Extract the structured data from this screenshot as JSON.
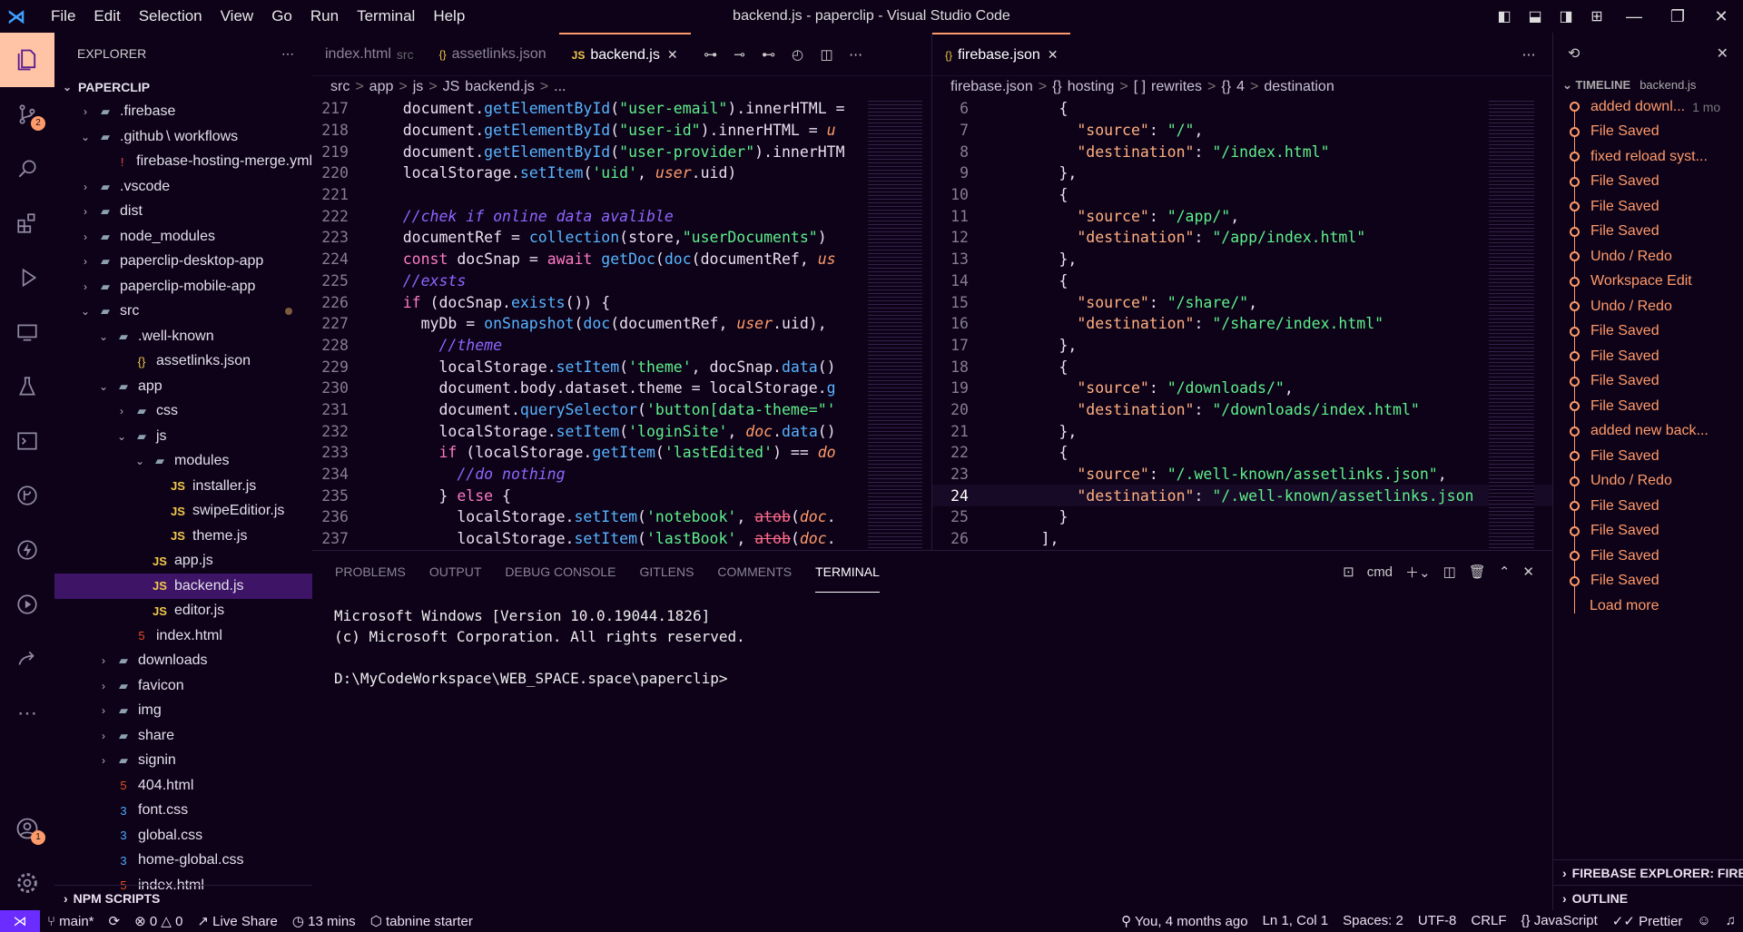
{
  "window": {
    "title": "backend.js - paperclip - Visual Studio Code"
  },
  "menu": [
    "File",
    "Edit",
    "Selection",
    "View",
    "Go",
    "Run",
    "Terminal",
    "Help"
  ],
  "activity": {
    "scm_badge": "2",
    "accounts_badge": "1"
  },
  "explorer": {
    "title": "EXPLORER",
    "root": "PAPERCLIP",
    "items": [
      {
        "label": ".firebase",
        "depth": 1,
        "kind": "folder",
        "open": false
      },
      {
        "label": ".github",
        "extra": "\\ workflows",
        "depth": 1,
        "kind": "folder",
        "open": true
      },
      {
        "label": "firebase-hosting-merge.yml",
        "depth": 2,
        "kind": "yml"
      },
      {
        "label": ".vscode",
        "depth": 1,
        "kind": "folder",
        "open": false
      },
      {
        "label": "dist",
        "depth": 1,
        "kind": "folder",
        "open": false
      },
      {
        "label": "node_modules",
        "depth": 1,
        "kind": "folder",
        "open": false
      },
      {
        "label": "paperclip-desktop-app",
        "depth": 1,
        "kind": "folder",
        "open": false
      },
      {
        "label": "paperclip-mobile-app",
        "depth": 1,
        "kind": "folder",
        "open": false
      },
      {
        "label": "src",
        "depth": 1,
        "kind": "folder",
        "open": true,
        "modified": true
      },
      {
        "label": ".well-known",
        "depth": 2,
        "kind": "folder",
        "open": true
      },
      {
        "label": "assetlinks.json",
        "depth": 3,
        "kind": "json"
      },
      {
        "label": "app",
        "depth": 2,
        "kind": "folder",
        "open": true
      },
      {
        "label": "css",
        "depth": 3,
        "kind": "folder",
        "open": false
      },
      {
        "label": "js",
        "depth": 3,
        "kind": "folder",
        "open": true
      },
      {
        "label": "modules",
        "depth": 4,
        "kind": "folder",
        "open": true
      },
      {
        "label": "installer.js",
        "depth": 5,
        "kind": "js"
      },
      {
        "label": "swipeEditior.js",
        "depth": 5,
        "kind": "js"
      },
      {
        "label": "theme.js",
        "depth": 5,
        "kind": "js"
      },
      {
        "label": "app.js",
        "depth": 4,
        "kind": "js"
      },
      {
        "label": "backend.js",
        "depth": 4,
        "kind": "js",
        "selected": true
      },
      {
        "label": "editor.js",
        "depth": 4,
        "kind": "js"
      },
      {
        "label": "index.html",
        "depth": 3,
        "kind": "html"
      },
      {
        "label": "downloads",
        "depth": 2,
        "kind": "folder",
        "open": false
      },
      {
        "label": "favicon",
        "depth": 2,
        "kind": "folder",
        "open": false
      },
      {
        "label": "img",
        "depth": 2,
        "kind": "folder",
        "open": false
      },
      {
        "label": "share",
        "depth": 2,
        "kind": "folder",
        "open": false
      },
      {
        "label": "signin",
        "depth": 2,
        "kind": "folder",
        "open": false
      },
      {
        "label": "404.html",
        "depth": 2,
        "kind": "html"
      },
      {
        "label": "font.css",
        "depth": 2,
        "kind": "css"
      },
      {
        "label": "global.css",
        "depth": 2,
        "kind": "css"
      },
      {
        "label": "home-global.css",
        "depth": 2,
        "kind": "css"
      },
      {
        "label": "index.html",
        "depth": 2,
        "kind": "html"
      }
    ],
    "npm_scripts": "NPM SCRIPTS"
  },
  "editor_left": {
    "tabs": [
      {
        "label": "index.html",
        "desc": "src",
        "kind": "html",
        "active": false
      },
      {
        "label": "assetlinks.json",
        "kind": "json",
        "active": false
      },
      {
        "label": "backend.js",
        "kind": "js",
        "active": true
      }
    ],
    "breadcrumb": [
      "src",
      ">",
      "app",
      ">",
      "js",
      ">",
      "JS",
      "backend.js",
      ">",
      "..."
    ],
    "lines": [
      {
        "n": "217",
        "tokens": [
          [
            "p",
            "    document."
          ],
          [
            "f",
            "getElementById"
          ],
          [
            "p",
            "("
          ],
          [
            "s",
            "\"user-email\""
          ],
          [
            "p",
            ").innerHTML = "
          ]
        ]
      },
      {
        "n": "218",
        "tokens": [
          [
            "p",
            "    document."
          ],
          [
            "f",
            "getElementById"
          ],
          [
            "p",
            "("
          ],
          [
            "s",
            "\"user-id\""
          ],
          [
            "p",
            ").innerHTML = "
          ],
          [
            "i",
            "u"
          ]
        ]
      },
      {
        "n": "219",
        "tokens": [
          [
            "p",
            "    document."
          ],
          [
            "f",
            "getElementById"
          ],
          [
            "p",
            "("
          ],
          [
            "s",
            "\"user-provider\""
          ],
          [
            "p",
            ").innerHTM"
          ]
        ]
      },
      {
        "n": "220",
        "tokens": [
          [
            "p",
            "    localStorage."
          ],
          [
            "f",
            "setItem"
          ],
          [
            "p",
            "("
          ],
          [
            "s",
            "'uid'"
          ],
          [
            "p",
            ", "
          ],
          [
            "i",
            "user"
          ],
          [
            "p",
            ".uid)"
          ]
        ]
      },
      {
        "n": "221",
        "tokens": [
          [
            "p",
            " "
          ]
        ]
      },
      {
        "n": "222",
        "tokens": [
          [
            "p",
            "    "
          ],
          [
            "c",
            "//chek if online data avalible"
          ]
        ]
      },
      {
        "n": "223",
        "tokens": [
          [
            "p",
            "    documentRef = "
          ],
          [
            "f",
            "collection"
          ],
          [
            "p",
            "(store,"
          ],
          [
            "s",
            "\"userDocuments\""
          ],
          [
            "p",
            ")"
          ]
        ]
      },
      {
        "n": "224",
        "tokens": [
          [
            "k",
            "    const "
          ],
          [
            "p",
            "docSnap = "
          ],
          [
            "k",
            "await "
          ],
          [
            "f",
            "getDoc"
          ],
          [
            "p",
            "("
          ],
          [
            "f",
            "doc"
          ],
          [
            "p",
            "(documentRef, "
          ],
          [
            "i",
            "us"
          ]
        ]
      },
      {
        "n": "225",
        "tokens": [
          [
            "p",
            "    "
          ],
          [
            "c",
            "//exsts"
          ]
        ]
      },
      {
        "n": "226",
        "tokens": [
          [
            "k",
            "    if "
          ],
          [
            "p",
            "(docSnap."
          ],
          [
            "f",
            "exists"
          ],
          [
            "p",
            "()) {"
          ]
        ]
      },
      {
        "n": "227",
        "tokens": [
          [
            "p",
            "      myDb = "
          ],
          [
            "f",
            "onSnapshot"
          ],
          [
            "p",
            "("
          ],
          [
            "f",
            "doc"
          ],
          [
            "p",
            "(documentRef, "
          ],
          [
            "i",
            "user"
          ],
          [
            "p",
            ".uid), "
          ]
        ]
      },
      {
        "n": "228",
        "tokens": [
          [
            "p",
            "        "
          ],
          [
            "c",
            "//theme"
          ]
        ]
      },
      {
        "n": "229",
        "tokens": [
          [
            "p",
            "        localStorage."
          ],
          [
            "f",
            "setItem"
          ],
          [
            "p",
            "("
          ],
          [
            "s",
            "'theme'"
          ],
          [
            "p",
            ", docSnap."
          ],
          [
            "f",
            "data"
          ],
          [
            "p",
            "()"
          ]
        ]
      },
      {
        "n": "230",
        "tokens": [
          [
            "p",
            "        document.body.dataset.theme = localStorage."
          ],
          [
            "f",
            "g"
          ]
        ]
      },
      {
        "n": "231",
        "tokens": [
          [
            "p",
            "        document."
          ],
          [
            "f",
            "querySelector"
          ],
          [
            "p",
            "("
          ],
          [
            "s",
            "'button[data-theme=\"'"
          ]
        ]
      },
      {
        "n": "232",
        "tokens": [
          [
            "p",
            "        localStorage."
          ],
          [
            "f",
            "setItem"
          ],
          [
            "p",
            "("
          ],
          [
            "s",
            "'loginSite'"
          ],
          [
            "p",
            ", "
          ],
          [
            "i",
            "doc"
          ],
          [
            "p",
            "."
          ],
          [
            "f",
            "data"
          ],
          [
            "p",
            "()"
          ]
        ]
      },
      {
        "n": "233",
        "tokens": [
          [
            "k",
            "        if "
          ],
          [
            "p",
            "(localStorage."
          ],
          [
            "f",
            "getItem"
          ],
          [
            "p",
            "("
          ],
          [
            "s",
            "'lastEdited'"
          ],
          [
            "p",
            ") == "
          ],
          [
            "i",
            "do"
          ]
        ]
      },
      {
        "n": "234",
        "tokens": [
          [
            "p",
            "          "
          ],
          [
            "c",
            "//do nothing"
          ]
        ]
      },
      {
        "n": "235",
        "tokens": [
          [
            "p",
            "        } "
          ],
          [
            "k",
            "else "
          ],
          [
            "p",
            "{"
          ]
        ]
      },
      {
        "n": "236",
        "tokens": [
          [
            "p",
            "          localStorage."
          ],
          [
            "f",
            "setItem"
          ],
          [
            "p",
            "("
          ],
          [
            "s",
            "'notebook'"
          ],
          [
            "p",
            ", "
          ],
          [
            "x",
            "atob"
          ],
          [
            "p",
            "("
          ],
          [
            "i",
            "doc"
          ],
          [
            "p",
            "."
          ]
        ]
      },
      {
        "n": "237",
        "tokens": [
          [
            "p",
            "          localStorage."
          ],
          [
            "f",
            "setItem"
          ],
          [
            "p",
            "("
          ],
          [
            "s",
            "'lastBook'"
          ],
          [
            "p",
            ", "
          ],
          [
            "x",
            "atob"
          ],
          [
            "p",
            "("
          ],
          [
            "i",
            "doc"
          ],
          [
            "p",
            "."
          ]
        ]
      }
    ]
  },
  "editor_right": {
    "tabs": [
      {
        "label": "firebase.json",
        "kind": "json",
        "active": true
      }
    ],
    "breadcrumb": [
      "firebase.json",
      ">",
      "{}",
      "hosting",
      ">",
      "[ ]",
      "rewrites",
      ">",
      "{}",
      "4",
      ">",
      "destination"
    ],
    "lines": [
      {
        "n": "6",
        "tokens": [
          [
            "p",
            "        {"
          ]
        ]
      },
      {
        "n": "7",
        "tokens": [
          [
            "y",
            "          \"source\""
          ],
          [
            "p",
            ": "
          ],
          [
            "s",
            "\"/\""
          ],
          [
            "p",
            ","
          ]
        ]
      },
      {
        "n": "8",
        "tokens": [
          [
            "y",
            "          \"destination\""
          ],
          [
            "p",
            ": "
          ],
          [
            "s",
            "\"/index.html\""
          ]
        ]
      },
      {
        "n": "9",
        "tokens": [
          [
            "p",
            "        },"
          ]
        ]
      },
      {
        "n": "10",
        "tokens": [
          [
            "p",
            "        {"
          ]
        ]
      },
      {
        "n": "11",
        "tokens": [
          [
            "y",
            "          \"source\""
          ],
          [
            "p",
            ": "
          ],
          [
            "s",
            "\"/app/\""
          ],
          [
            "p",
            ","
          ]
        ]
      },
      {
        "n": "12",
        "tokens": [
          [
            "y",
            "          \"destination\""
          ],
          [
            "p",
            ": "
          ],
          [
            "s",
            "\"/app/index.html\""
          ]
        ]
      },
      {
        "n": "13",
        "tokens": [
          [
            "p",
            "        },"
          ]
        ]
      },
      {
        "n": "14",
        "tokens": [
          [
            "p",
            "        {"
          ]
        ]
      },
      {
        "n": "15",
        "tokens": [
          [
            "y",
            "          \"source\""
          ],
          [
            "p",
            ": "
          ],
          [
            "s",
            "\"/share/\""
          ],
          [
            "p",
            ","
          ]
        ]
      },
      {
        "n": "16",
        "tokens": [
          [
            "y",
            "          \"destination\""
          ],
          [
            "p",
            ": "
          ],
          [
            "s",
            "\"/share/index.html\""
          ]
        ]
      },
      {
        "n": "17",
        "tokens": [
          [
            "p",
            "        },"
          ]
        ]
      },
      {
        "n": "18",
        "tokens": [
          [
            "p",
            "        {"
          ]
        ]
      },
      {
        "n": "19",
        "tokens": [
          [
            "y",
            "          \"source\""
          ],
          [
            "p",
            ": "
          ],
          [
            "s",
            "\"/downloads/\""
          ],
          [
            "p",
            ","
          ]
        ]
      },
      {
        "n": "20",
        "tokens": [
          [
            "y",
            "          \"destination\""
          ],
          [
            "p",
            ": "
          ],
          [
            "s",
            "\"/downloads/index.html\""
          ]
        ]
      },
      {
        "n": "21",
        "tokens": [
          [
            "p",
            "        },"
          ]
        ]
      },
      {
        "n": "22",
        "tokens": [
          [
            "p",
            "        {"
          ]
        ]
      },
      {
        "n": "23",
        "tokens": [
          [
            "y",
            "          \"source\""
          ],
          [
            "p",
            ": "
          ],
          [
            "s",
            "\"/.well-known/assetlinks.json\""
          ],
          [
            "p",
            ","
          ]
        ]
      },
      {
        "n": "24",
        "tokens": [
          [
            "y",
            "          \"destination\""
          ],
          [
            "p",
            ": "
          ],
          [
            "s",
            "\"/.well-known/assetlinks.json"
          ]
        ],
        "current": true
      },
      {
        "n": "25",
        "tokens": [
          [
            "p",
            "        }"
          ]
        ]
      },
      {
        "n": "26",
        "tokens": [
          [
            "p",
            "      ],"
          ]
        ]
      }
    ]
  },
  "panel": {
    "tabs": [
      "PROBLEMS",
      "OUTPUT",
      "DEBUG CONSOLE",
      "GITLENS",
      "COMMENTS",
      "TERMINAL"
    ],
    "active_tab": "TERMINAL",
    "shell": "cmd",
    "terminal": "Microsoft Windows [Version 10.0.19044.1826]\n(c) Microsoft Corporation. All rights reserved.\n\nD:\\MyCodeWorkspace\\WEB_SPACE.space\\paperclip>"
  },
  "timeline": {
    "title": "TIMELINE",
    "file": "backend.js",
    "items": [
      {
        "label": "added downl...",
        "when": "1 mo"
      },
      {
        "label": "File Saved"
      },
      {
        "label": "fixed reload syst..."
      },
      {
        "label": "File Saved"
      },
      {
        "label": "File Saved"
      },
      {
        "label": "File Saved"
      },
      {
        "label": "Undo / Redo"
      },
      {
        "label": "Workspace Edit"
      },
      {
        "label": "Undo / Redo"
      },
      {
        "label": "File Saved"
      },
      {
        "label": "File Saved"
      },
      {
        "label": "File Saved"
      },
      {
        "label": "File Saved"
      },
      {
        "label": "added new back..."
      },
      {
        "label": "File Saved"
      },
      {
        "label": "Undo / Redo"
      },
      {
        "label": "File Saved"
      },
      {
        "label": "File Saved"
      },
      {
        "label": "File Saved"
      },
      {
        "label": "File Saved"
      }
    ],
    "load_more": "Load more",
    "firebase_explorer": "FIREBASE EXPLORER: FIRE...",
    "outline": "OUTLINE"
  },
  "status": {
    "branch": "main*",
    "errors": "0",
    "warnings": "0",
    "live_share": "Live Share",
    "time": "13 mins",
    "tabnine": "tabnine starter",
    "blame": "You, 4 months ago",
    "position": "Ln 1, Col 1",
    "spaces": "Spaces: 2",
    "encoding": "UTF-8",
    "eol": "CRLF",
    "language": "JavaScript",
    "formatter": "Prettier"
  }
}
